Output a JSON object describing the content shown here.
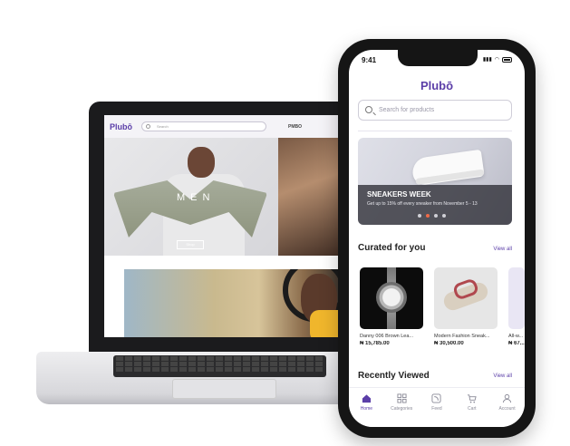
{
  "laptop": {
    "logo": "Plubō",
    "search_placeholder": "Search",
    "nav_item": "PMBO",
    "hero_text": "MEN",
    "hero_button": "Shop"
  },
  "phone": {
    "status_time": "9:41",
    "logo": "Plubō",
    "search_placeholder": "Search for products",
    "banner": {
      "title": "SNEAKERS WEEK",
      "subtitle": "Get up to 15% off every sneaker from November 5 - 13",
      "dots": 4,
      "active_dot": 1
    },
    "curated": {
      "title": "Curated for you",
      "view_all": "View all",
      "products": [
        {
          "name": "Danny 006 Brown Lea...",
          "price": "₦ 15,785.00"
        },
        {
          "name": "Modern Fashion Sneak...",
          "price": "₦ 30,500.00"
        },
        {
          "name": "All-w...",
          "price": "₦ 67..."
        }
      ]
    },
    "recent": {
      "title": "Recently Viewed",
      "view_all": "View all"
    },
    "tabs": [
      {
        "label": "Home",
        "icon": "home-icon",
        "active": true
      },
      {
        "label": "Categories",
        "icon": "categories-icon",
        "active": false
      },
      {
        "label": "Feed",
        "icon": "feed-icon",
        "active": false
      },
      {
        "label": "Cart",
        "icon": "cart-icon",
        "active": false
      },
      {
        "label": "Account",
        "icon": "account-icon",
        "active": false
      }
    ]
  },
  "colors": {
    "brand": "#5b3ea8",
    "accent_dot": "#f06a47"
  }
}
